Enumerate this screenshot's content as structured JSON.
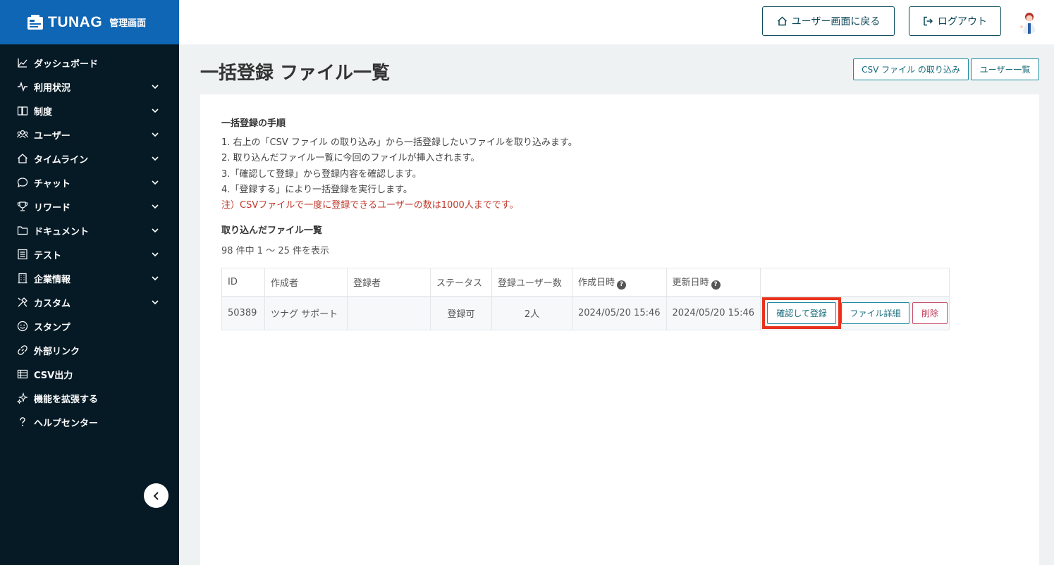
{
  "brand": {
    "name": "TUNAG",
    "sub": "管理画面"
  },
  "sidebar": {
    "items": [
      {
        "label": "ダッシュボード",
        "icon": "chart-icon",
        "expandable": false
      },
      {
        "label": "利用状況",
        "icon": "pulse-icon",
        "expandable": true
      },
      {
        "label": "制度",
        "icon": "book-icon",
        "expandable": true
      },
      {
        "label": "ユーザー",
        "icon": "users-icon",
        "expandable": true
      },
      {
        "label": "タイムライン",
        "icon": "home-icon",
        "expandable": true
      },
      {
        "label": "チャット",
        "icon": "chat-icon",
        "expandable": true
      },
      {
        "label": "リワード",
        "icon": "trophy-icon",
        "expandable": true
      },
      {
        "label": "ドキュメント",
        "icon": "folder-icon",
        "expandable": true
      },
      {
        "label": "テスト",
        "icon": "checklist-icon",
        "expandable": true
      },
      {
        "label": "企業情報",
        "icon": "building-icon",
        "expandable": true
      },
      {
        "label": "カスタム",
        "icon": "tools-icon",
        "expandable": true
      },
      {
        "label": "スタンプ",
        "icon": "smile-icon",
        "expandable": false
      },
      {
        "label": "外部リンク",
        "icon": "link-icon",
        "expandable": false
      },
      {
        "label": "CSV出力",
        "icon": "table-icon",
        "expandable": false
      },
      {
        "label": "機能を拡張する",
        "icon": "sparkle-icon",
        "expandable": false
      },
      {
        "label": "ヘルプセンター",
        "icon": "help-icon",
        "expandable": false
      }
    ]
  },
  "header": {
    "back_label": "ユーザー画面に戻る",
    "logout_label": "ログアウト"
  },
  "main": {
    "title": "一括登録 ファイル一覧",
    "import_button": "CSV ファイル の取り込み",
    "users_button": "ユーザー一覧",
    "procedure_title": "一括登録の手順",
    "steps": [
      "1. 右上の「CSV ファイル の取り込み」から一括登録したいファイルを取り込みます。",
      "2. 取り込んだファイル一覧に今回のファイルが挿入されます。",
      "3.「確認して登録」から登録内容を確認します。",
      "4.「登録する」により一括登録を実行します。"
    ],
    "note": "注）CSVファイルで一度に登録できるユーザーの数は1000人までです。",
    "list_title": "取り込んだファイル一覧",
    "count_text": "98 件中 1 〜 25 件を表示",
    "table": {
      "headers": [
        "ID",
        "作成者",
        "登録者",
        "ステータス",
        "登録ユーザー数",
        "作成日時",
        "更新日時",
        ""
      ],
      "rows": [
        {
          "id": "50389",
          "creator": "ツナグ サポート",
          "registrant": "",
          "status": "登録可",
          "user_count": "2人",
          "created": "2024/05/20 15:46",
          "updated": "2024/05/20 15:46",
          "confirm_label": "確認して登録",
          "detail_label": "ファイル詳細",
          "delete_label": "削除"
        }
      ]
    }
  },
  "colors": {
    "brand_blue": "#0f66b4",
    "sidebar_bg": "#061a26",
    "accent_teal": "#1b8a9c",
    "note_red": "#c0392b",
    "highlight_red": "#e8321d"
  }
}
